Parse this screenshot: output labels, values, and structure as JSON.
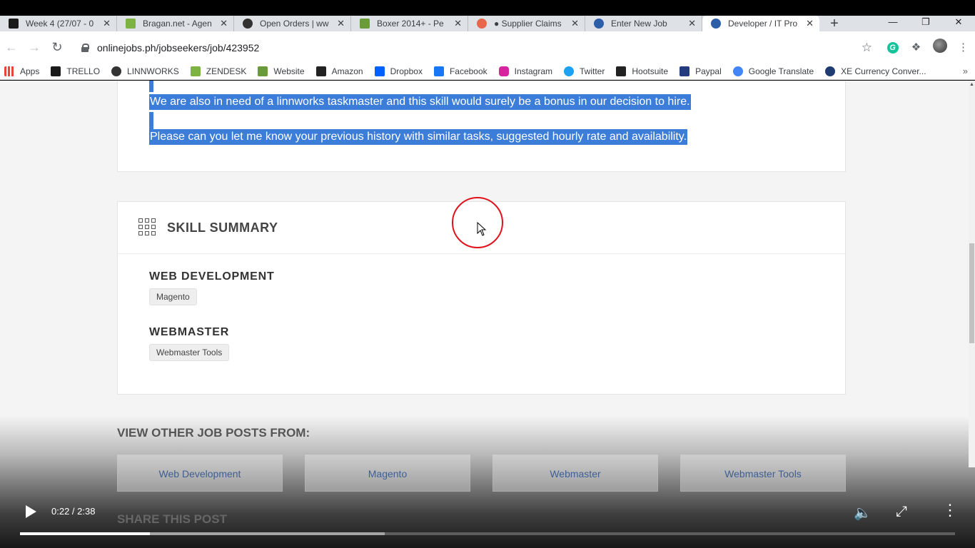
{
  "browser": {
    "tabs": [
      {
        "title": "Week 4 (27/07 - 0",
        "favicon_color": "#1a1a1a"
      },
      {
        "title": "Bragan.net - Agen",
        "favicon_color": "#7cb342"
      },
      {
        "title": "Open Orders | ww",
        "favicon_color": "#333333"
      },
      {
        "title": "Boxer 2014+ - Pe",
        "favicon_color": "#6a9b3a"
      },
      {
        "title": "● Supplier Claims",
        "favicon_color": "#e8664c"
      },
      {
        "title": "Enter New Job",
        "favicon_color": "#2d5ea8"
      },
      {
        "title": "Developer / IT Pro",
        "favicon_color": "#2d5ea8"
      }
    ],
    "new_tab_symbol": "+",
    "close_symbol": "✕",
    "url": "onlinejobs.ph/jobseekers/job/423952",
    "window_controls": {
      "minimize": "—",
      "restore": "❐",
      "close": "✕"
    }
  },
  "bookmarks": [
    {
      "label": "Apps",
      "icon": "apps-grid-icon",
      "color": "#e8453c"
    },
    {
      "label": "TRELLO",
      "icon": "trello-icon",
      "color": "#1a1a1a"
    },
    {
      "label": "LINNWORKS",
      "icon": "linnworks-icon",
      "color": "#333333"
    },
    {
      "label": "ZENDESK",
      "icon": "zendesk-icon",
      "color": "#7cb342"
    },
    {
      "label": "Website",
      "icon": "website-icon",
      "color": "#6a9b3a"
    },
    {
      "label": "Amazon",
      "icon": "amazon-icon",
      "color": "#222222"
    },
    {
      "label": "Dropbox",
      "icon": "dropbox-icon",
      "color": "#0061fe"
    },
    {
      "label": "Facebook",
      "icon": "facebook-icon",
      "color": "#1877f2"
    },
    {
      "label": "Instagram",
      "icon": "instagram-icon",
      "color": "#d6249f"
    },
    {
      "label": "Twitter",
      "icon": "twitter-icon",
      "color": "#1da1f2"
    },
    {
      "label": "Hootsuite",
      "icon": "hootsuite-icon",
      "color": "#222222"
    },
    {
      "label": "Paypal",
      "icon": "paypal-icon",
      "color": "#253b80"
    },
    {
      "label": "Google Translate",
      "icon": "google-icon",
      "color": "#4285f4"
    },
    {
      "label": "XE Currency Conver...",
      "icon": "xe-icon",
      "color": "#1e3c72"
    }
  ],
  "job": {
    "para1": "We are also in need of a linnworks taskmaster and this skill would surely be a bonus in our decision to hire.",
    "para2": "Please can you let me know your previous history with similar tasks, suggested hourly rate and availability.",
    "skill_summary_title": "SKILL SUMMARY",
    "skills": [
      {
        "category": "WEB DEVELOPMENT",
        "tag": "Magento"
      },
      {
        "category": "WEBMASTER",
        "tag": "Webmaster Tools"
      }
    ],
    "view_other_title": "VIEW OTHER JOB POSTS FROM:",
    "other_categories": [
      "Web Development",
      "Magento",
      "Webmaster",
      "Webmaster Tools"
    ],
    "share_title": "SHARE THIS POST"
  },
  "video": {
    "time": "0:22 / 2:38",
    "played_fraction": 0.139,
    "buffered_fraction": 0.39,
    "ring_color": "#e0121c"
  }
}
